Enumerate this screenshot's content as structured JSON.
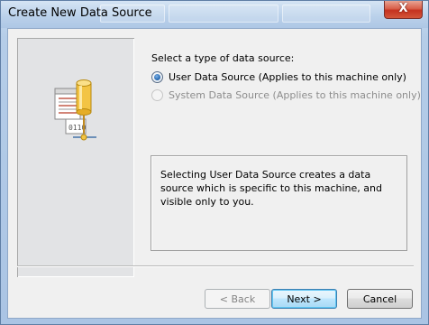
{
  "window": {
    "title": "Create New Data Source",
    "close_glyph": "X"
  },
  "prompt": "Select a type of data source:",
  "options": [
    {
      "label": "User Data Source (Applies to this machine only)",
      "selected": true,
      "enabled": true
    },
    {
      "label": "System Data Source (Applies to this machine only)",
      "selected": false,
      "enabled": false
    }
  ],
  "description": "Selecting User Data Source creates a data source which is specific to this machine, and visible only to you.",
  "buttons": {
    "back": "< Back",
    "next": "Next >",
    "cancel": "Cancel"
  },
  "icon": {
    "name": "data-source-icon",
    "caption": "0110"
  },
  "colors": {
    "accent": "#3c7fb1",
    "titlebar": "#b9d0ea",
    "close": "#c5321f"
  }
}
